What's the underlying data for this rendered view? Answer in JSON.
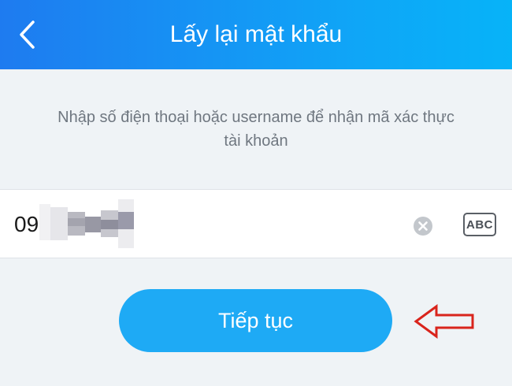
{
  "header": {
    "title": "Lấy lại mật khẩu",
    "back_icon": "chevron-left-icon"
  },
  "description": {
    "line1": "Nhập số điện thoại hoặc username để nhận mã xác thực",
    "line2": "tài khoản"
  },
  "phone_field": {
    "value": "09",
    "placeholder": ""
  },
  "keyboard_toggle": {
    "label": "ABC"
  },
  "continue_button": {
    "label": "Tiếp tục"
  },
  "colors": {
    "header_start": "#1e7bf0",
    "header_end": "#07b3f8",
    "button": "#1eaaf5",
    "annotation_arrow": "#d9241c",
    "background": "#eff3f6"
  }
}
